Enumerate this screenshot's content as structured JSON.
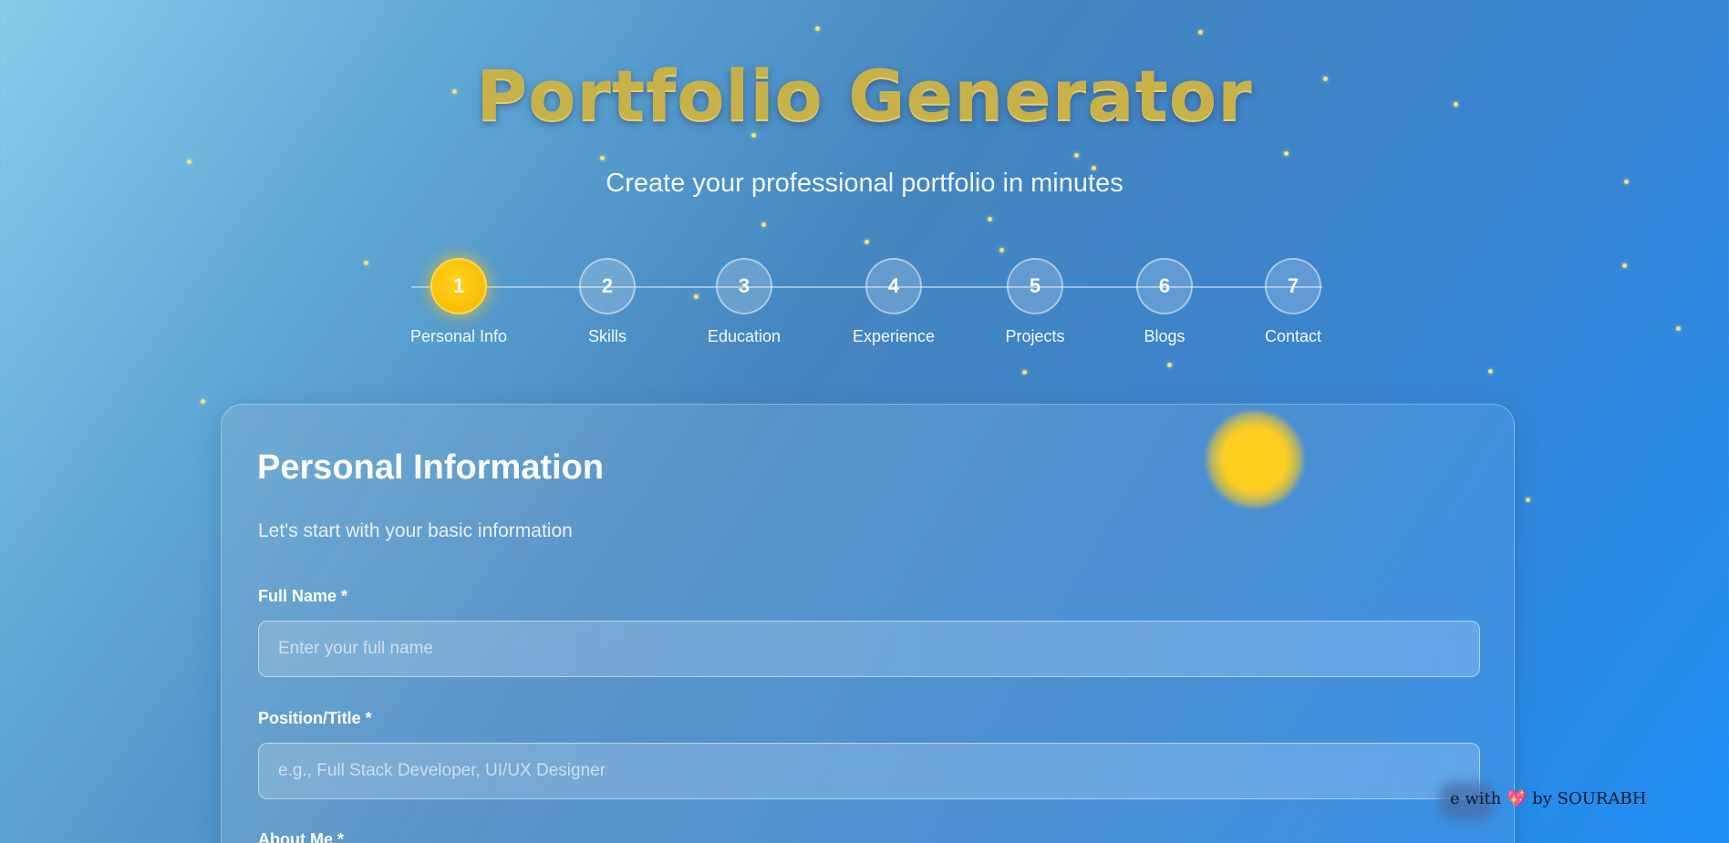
{
  "header": {
    "title": "Portfolio Generator",
    "subtitle": "Create your professional portfolio in minutes"
  },
  "steps": [
    {
      "number": "1",
      "label": "Personal Info",
      "active": true
    },
    {
      "number": "2",
      "label": "Skills",
      "active": false
    },
    {
      "number": "3",
      "label": "Education",
      "active": false
    },
    {
      "number": "4",
      "label": "Experience",
      "active": false
    },
    {
      "number": "5",
      "label": "Projects",
      "active": false
    },
    {
      "number": "6",
      "label": "Blogs",
      "active": false
    },
    {
      "number": "7",
      "label": "Contact",
      "active": false
    }
  ],
  "form": {
    "heading": "Personal Information",
    "description": "Let's start with your basic information",
    "fields": [
      {
        "label": "Full Name *",
        "placeholder": "Enter your full name",
        "value": ""
      },
      {
        "label": "Position/Title *",
        "placeholder": "e.g., Full Stack Developer, UI/UX Designer",
        "value": ""
      },
      {
        "label": "About Me *"
      }
    ]
  },
  "footer": {
    "text_before": "e with",
    "heart": "💖",
    "text_after": "by SOURABH"
  },
  "colors": {
    "accent": "#ffd21c",
    "title_gold": "#c9b14a",
    "background_start": "#86cdea",
    "background_end": "#1f8ff5"
  }
}
